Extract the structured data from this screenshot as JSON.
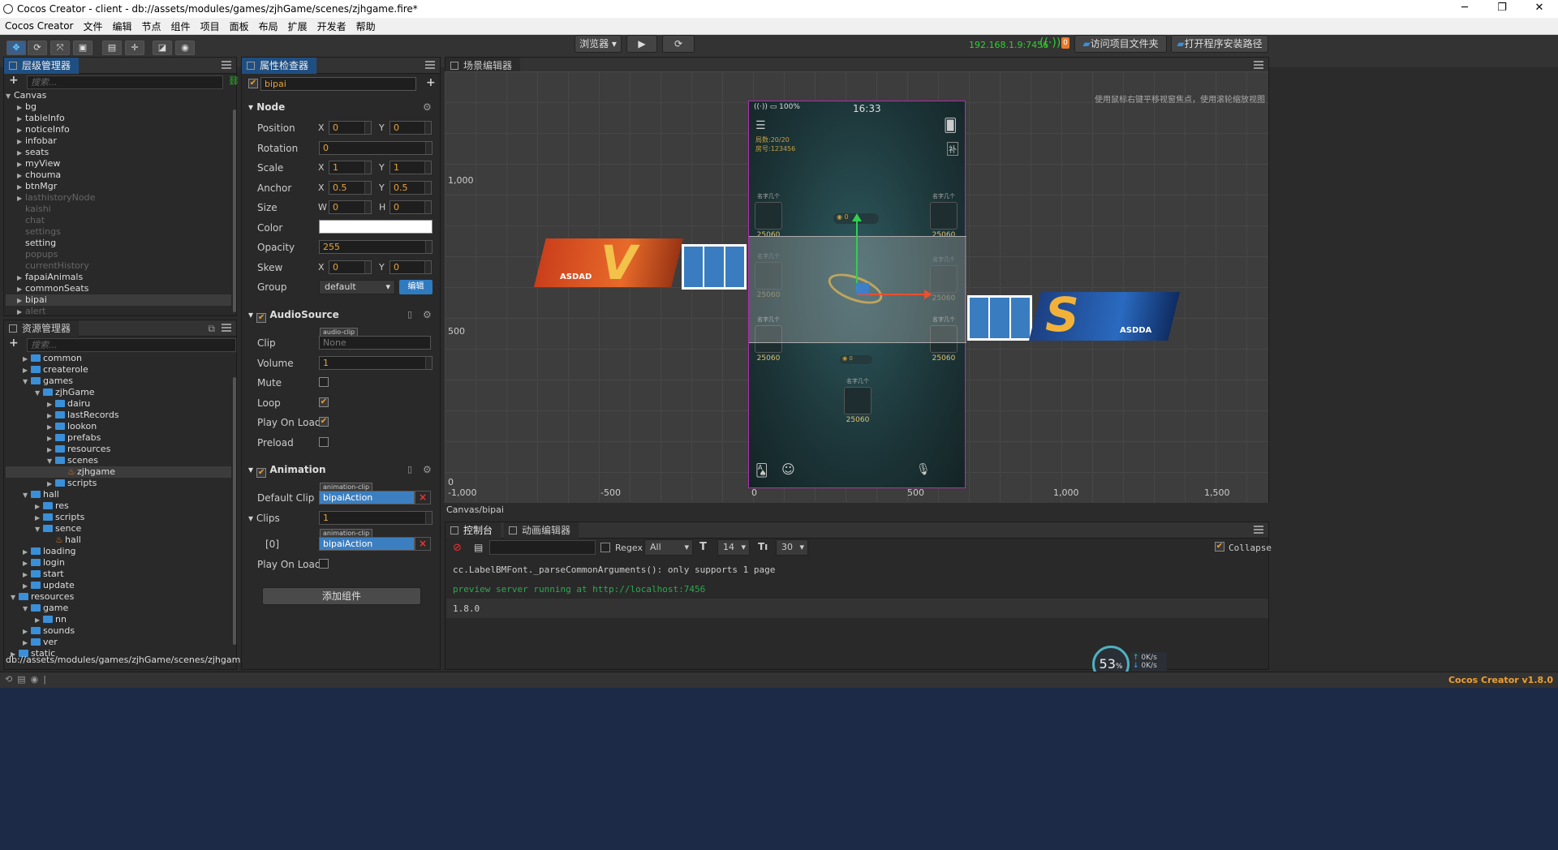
{
  "window": {
    "title": "Cocos Creator - client - db://assets/modules/games/zjhGame/scenes/zjhgame.fire*",
    "min": "─",
    "max": "❐",
    "close": "✕"
  },
  "menu": [
    "Cocos Creator",
    "文件",
    "编辑",
    "节点",
    "组件",
    "项目",
    "面板",
    "布局",
    "扩展",
    "开发者",
    "帮助"
  ],
  "toolbar": {
    "preview_select": "浏览器",
    "ip": "192.168.1.9:7456",
    "notif_count": "0",
    "open_project_btn": "访问项目文件夹",
    "open_install_btn": "打开程序安装路径"
  },
  "hierarchy": {
    "title": "层级管理器",
    "search_placeholder": "搜索...",
    "root": "Canvas",
    "items": [
      {
        "label": "bg",
        "dim": false
      },
      {
        "label": "tableInfo",
        "dim": false
      },
      {
        "label": "noticeInfo",
        "dim": false
      },
      {
        "label": "infobar",
        "dim": false
      },
      {
        "label": "seats",
        "dim": false
      },
      {
        "label": "myView",
        "dim": false
      },
      {
        "label": "chouma",
        "dim": false
      },
      {
        "label": "btnMgr",
        "dim": false
      },
      {
        "label": "lasthistoryNode",
        "dim": true
      },
      {
        "label": "kaishi",
        "dim": true
      },
      {
        "label": "chat",
        "dim": true
      },
      {
        "label": "settings",
        "dim": true
      },
      {
        "label": "setting",
        "dim": false
      },
      {
        "label": "popups",
        "dim": true
      },
      {
        "label": "currentHistory",
        "dim": true
      },
      {
        "label": "fapaiAnimals",
        "dim": false
      },
      {
        "label": "commonSeats",
        "dim": false
      },
      {
        "label": "bipai",
        "dim": false
      },
      {
        "label": "alert",
        "dim": true
      }
    ]
  },
  "assets": {
    "title": "资源管理器",
    "search_placeholder": "搜索...",
    "items": [
      "common",
      "createrole",
      "games",
      "zjhGame",
      "dairu",
      "lastRecords",
      "lookon",
      "prefabs",
      "resources",
      "scenes",
      "zjhgame",
      "scripts",
      "hall",
      "res",
      "scripts",
      "sence",
      "hall",
      "loading",
      "login",
      "start",
      "update",
      "resources",
      "game",
      "nn",
      "sounds",
      "ver",
      "static"
    ],
    "path": "db://assets/modules/games/zjhGame/scenes/zjhgame.fire"
  },
  "inspector": {
    "title": "属性检查器",
    "node_name": "bipai",
    "node_section": "Node",
    "position_label": "Position",
    "pos_x": "0",
    "pos_y": "0",
    "rotation_label": "Rotation",
    "rotation": "0",
    "scale_label": "Scale",
    "scale_x": "1",
    "scale_y": "1",
    "anchor_label": "Anchor",
    "anchor_x": "0.5",
    "anchor_y": "0.5",
    "size_label": "Size",
    "size_w": "0",
    "size_h": "0",
    "color_label": "Color",
    "opacity_label": "Opacity",
    "opacity": "255",
    "skew_label": "Skew",
    "skew_x": "0",
    "skew_y": "0",
    "group_label": "Group",
    "group": "default",
    "edit_btn": "编辑",
    "x": "X",
    "y": "Y",
    "w": "W",
    "h": "H",
    "audio_section": "AudioSource",
    "clip_label": "Clip",
    "clip_tag": "audio-clip",
    "clip_value": "None",
    "volume_label": "Volume",
    "volume": "1",
    "mute_label": "Mute",
    "loop_label": "Loop",
    "play_on_load_label": "Play On Load",
    "preload_label": "Preload",
    "anim_section": "Animation",
    "default_clip_label": "Default Clip",
    "anim_tag": "animation-clip",
    "default_clip": "bipaiAction",
    "clips_label": "Clips",
    "clips_count": "1",
    "clip0_label": "[0]",
    "clip0": "bipaiAction",
    "anim_play_on_load_label": "Play On Load",
    "add_component_btn": "添加组件"
  },
  "scene": {
    "title": "场景编辑器",
    "hint": "使用鼠标右键平移视窗焦点，使用滚轮缩放视图",
    "y_labels": [
      "1,000",
      "500",
      "0"
    ],
    "x_labels": [
      "-1,000",
      "-500",
      "0",
      "500",
      "1,000",
      "1,500"
    ],
    "breadcrumb": "Canvas/bipai",
    "device": {
      "battery": "100%",
      "time": "16:33",
      "rounds": "局数:20/20",
      "room": "房号:123456",
      "seat_name": "名字几个",
      "score": "25060",
      "chip": "0"
    },
    "left_banner": "ASDAD",
    "right_banner": "ASDDA"
  },
  "console": {
    "tab_console": "控制台",
    "tab_anim": "动画编辑器",
    "regex_label": "Regex",
    "filter_level": "All",
    "font_size": "14",
    "line_height": "30",
    "collapse_label": "Collapse",
    "lines": [
      {
        "text": "cc.LabelBMFont._parseCommonArguments(): only supports 1 page",
        "color": "#cccccc"
      },
      {
        "text": "preview server running at http://localhost:7456",
        "color": "#2fa84f"
      },
      {
        "text": "1.8.0",
        "color": "#cccccc"
      }
    ],
    "cpu_percent": "53",
    "net_up": "0",
    "net_down": "0",
    "net_unit": "K/s"
  },
  "status": {
    "version": "Cocos Creator v1.8.0"
  },
  "colors": {
    "accent": "#1f4f82",
    "ip": "#32cd32",
    "version": "#f0a030"
  }
}
